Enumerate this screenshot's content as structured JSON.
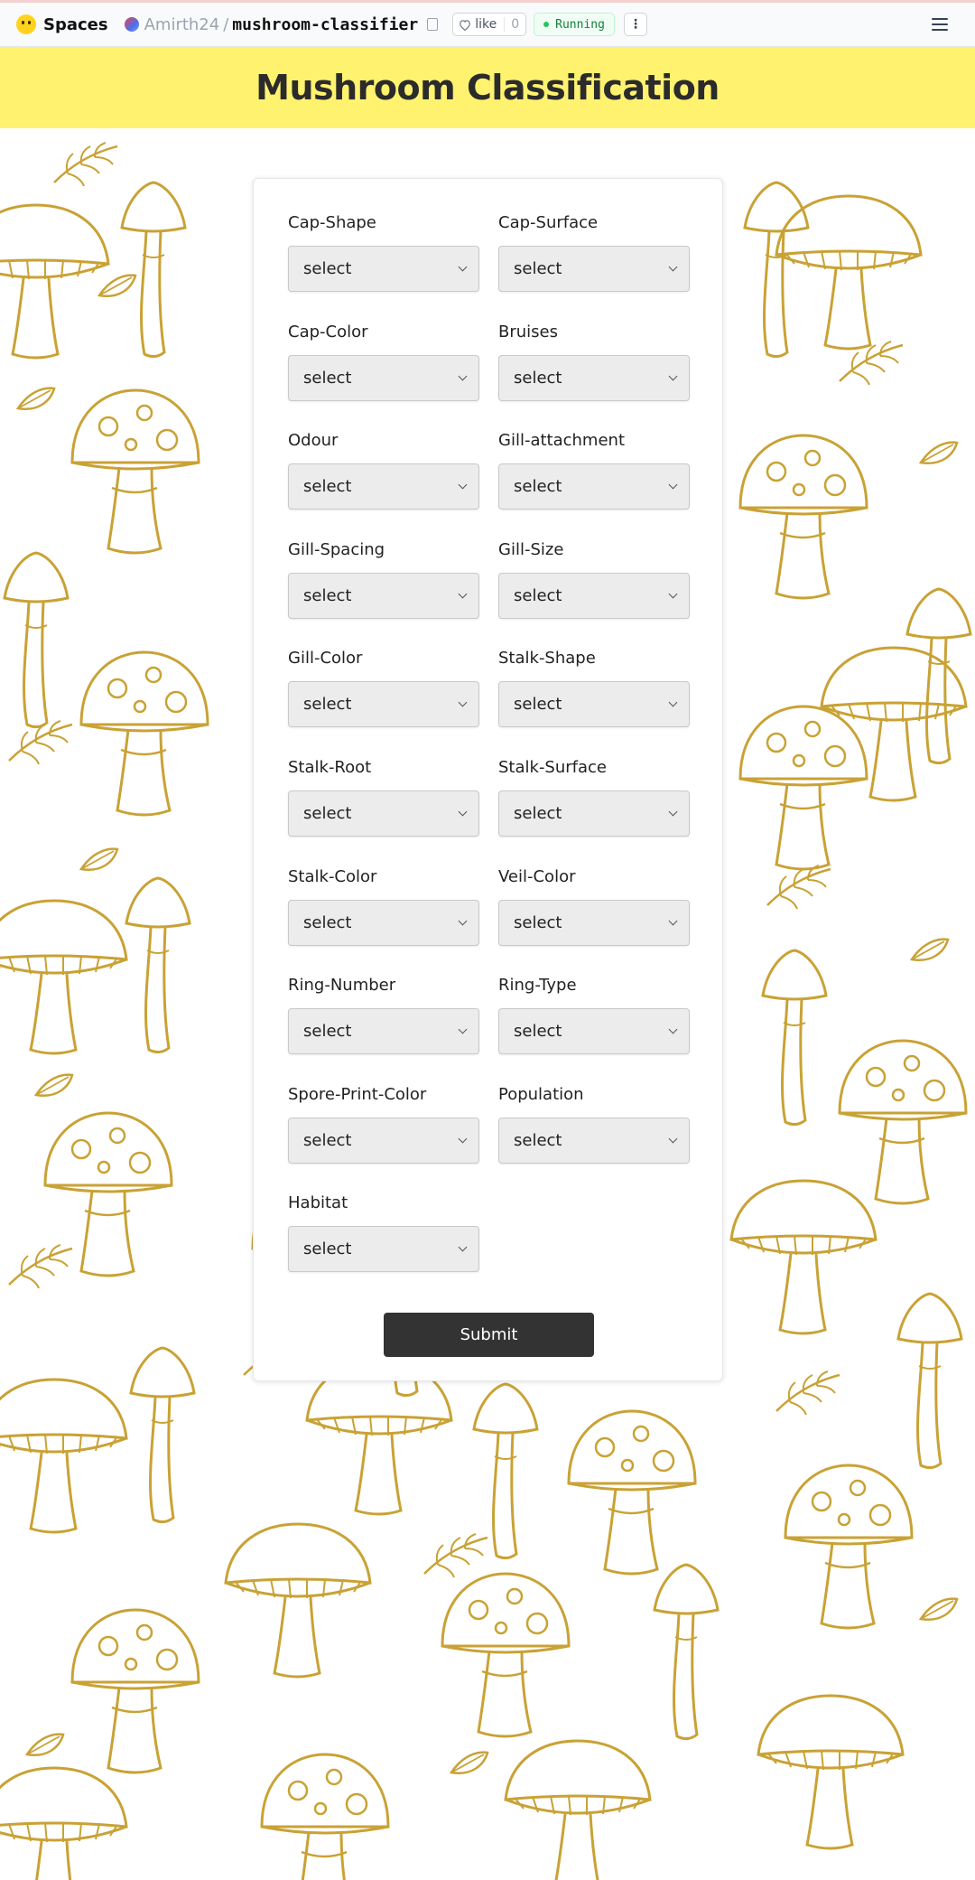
{
  "topbar": {
    "spaces_label": "Spaces",
    "owner": "Amirth24",
    "separator": "/",
    "repo": "mushroom-classifier",
    "like_label": "like",
    "like_count": "0",
    "status": "Running",
    "more_label": "⋮"
  },
  "page": {
    "title": "Mushroom Classification"
  },
  "form": {
    "fields": [
      {
        "label": "Cap-Shape",
        "value": "select"
      },
      {
        "label": "Cap-Surface",
        "value": "select"
      },
      {
        "label": "Cap-Color",
        "value": "select"
      },
      {
        "label": "Bruises",
        "value": "select"
      },
      {
        "label": "Odour",
        "value": "select"
      },
      {
        "label": "Gill-attachment",
        "value": "select"
      },
      {
        "label": "Gill-Spacing",
        "value": "select"
      },
      {
        "label": "Gill-Size",
        "value": "select"
      },
      {
        "label": "Gill-Color",
        "value": "select"
      },
      {
        "label": "Stalk-Shape",
        "value": "select"
      },
      {
        "label": "Stalk-Root",
        "value": "select"
      },
      {
        "label": "Stalk-Surface",
        "value": "select"
      },
      {
        "label": "Stalk-Color",
        "value": "select"
      },
      {
        "label": "Veil-Color",
        "value": "select"
      },
      {
        "label": "Ring-Number",
        "value": "select"
      },
      {
        "label": "Ring-Type",
        "value": "select"
      },
      {
        "label": "Spore-Print-Color",
        "value": "select"
      },
      {
        "label": "Population",
        "value": "select"
      },
      {
        "label": "Habitat",
        "value": "select"
      }
    ],
    "submit_label": "Submit"
  },
  "colors": {
    "header_band": "#fff26f",
    "pattern_stroke": "#c9a235",
    "submit_bg": "#333333"
  }
}
